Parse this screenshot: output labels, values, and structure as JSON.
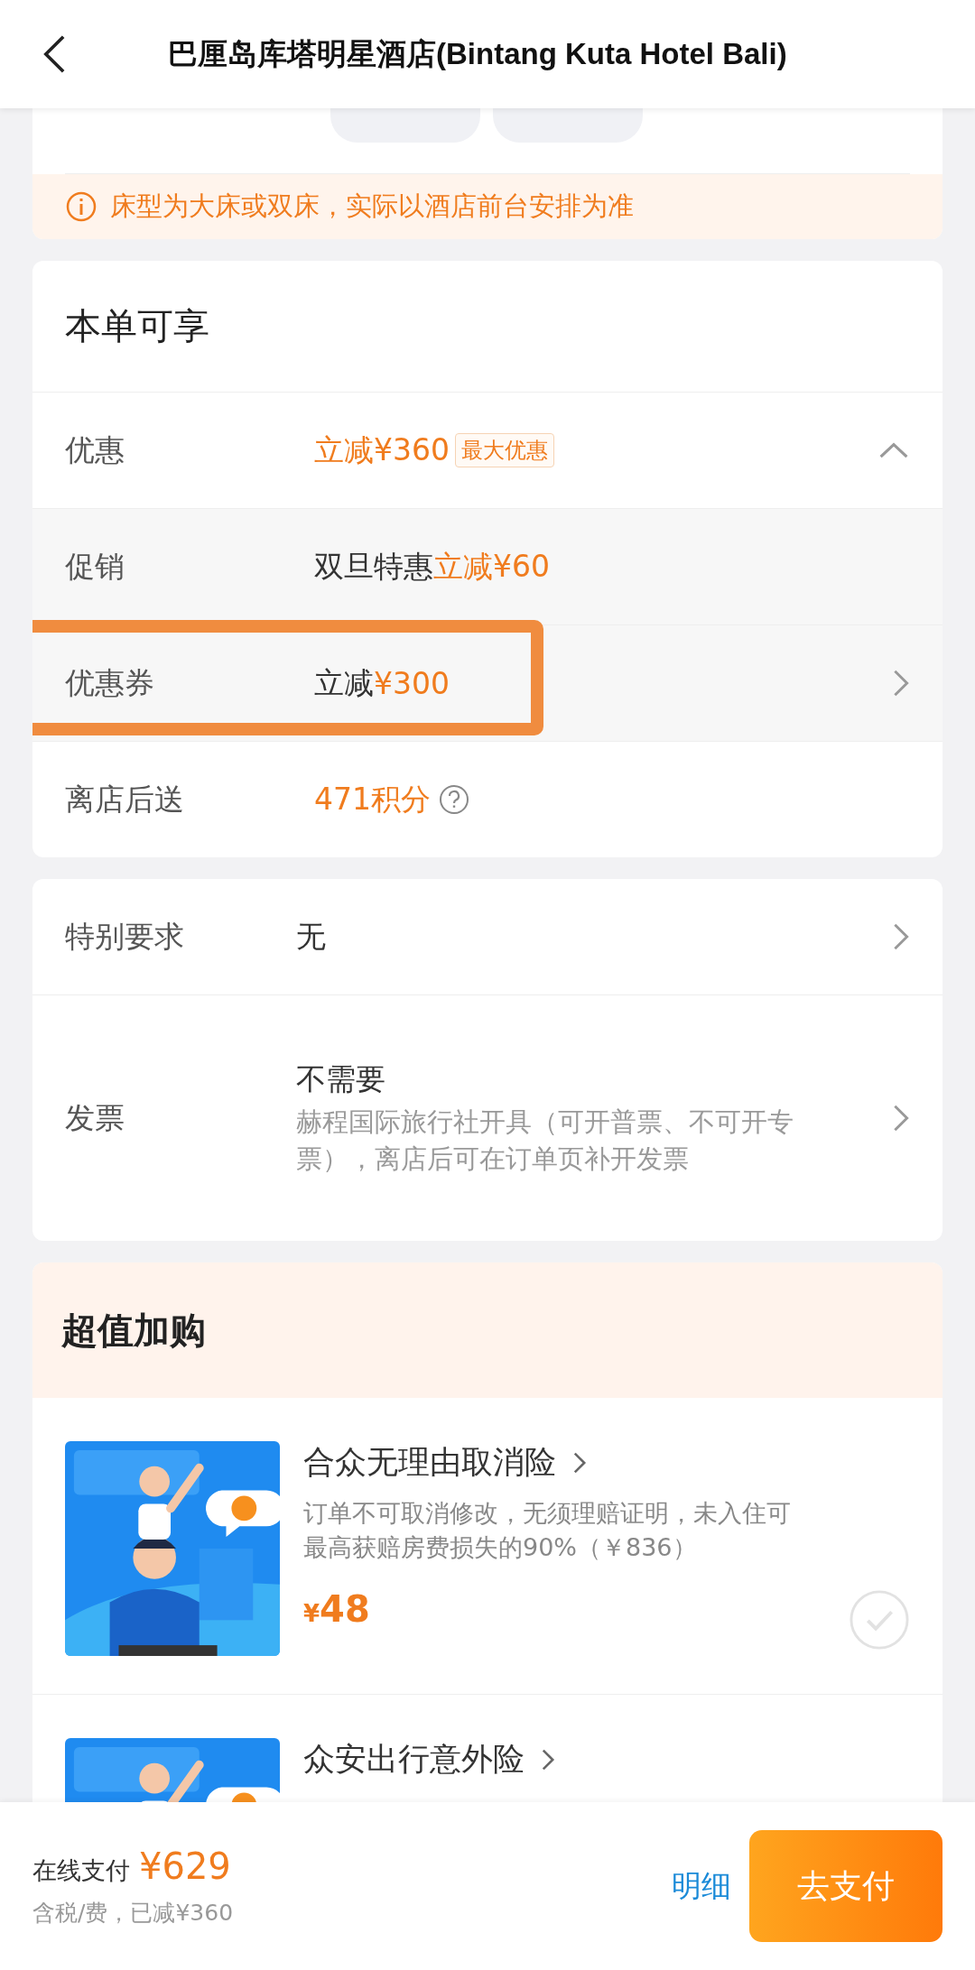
{
  "header": {
    "title": "巴厘岛库塔明星酒店(Bintang Kuta Hotel Bali)"
  },
  "bed_notice": "床型为大床或双床，实际以酒店前台安排为准",
  "benefits": {
    "title": "本单可享",
    "rows": [
      {
        "kind": "summary",
        "label": "优惠",
        "prefix": "",
        "amount": "立减¥360",
        "badge": "最大优惠",
        "expanded": true,
        "highlighted": false
      },
      {
        "kind": "detail",
        "label": "促销",
        "prefix": "双旦特惠",
        "amount": "立减¥60",
        "link": false,
        "highlighted": false
      },
      {
        "kind": "detail",
        "label": "优惠券",
        "prefix": "立减",
        "amount": "¥300",
        "link": true,
        "highlighted": true
      },
      {
        "kind": "points",
        "label": "离店后送",
        "prefix": "",
        "amount": "471积分",
        "highlighted": false
      }
    ]
  },
  "requests": [
    {
      "label": "特别要求",
      "value": "无"
    },
    {
      "label": "发票",
      "value": "不需要",
      "note": "赫程国际旅行社开具（可开普票、不可开专票），离店后可在订单页补开发票"
    }
  ],
  "addons": {
    "title": "超值加购",
    "items": [
      {
        "name": "合众无理由取消险",
        "description": "订单不可取消修改，无须理赔证明，未入住可最高获赔房费损失的90%（￥836）",
        "currency": "¥",
        "price": "48",
        "checked": false
      },
      {
        "name": "众安出行意外险"
      }
    ]
  },
  "footer": {
    "label": "在线支付",
    "total": "¥629",
    "note": "含税/费，已减¥360",
    "details": "明细",
    "pay": "去支付"
  }
}
